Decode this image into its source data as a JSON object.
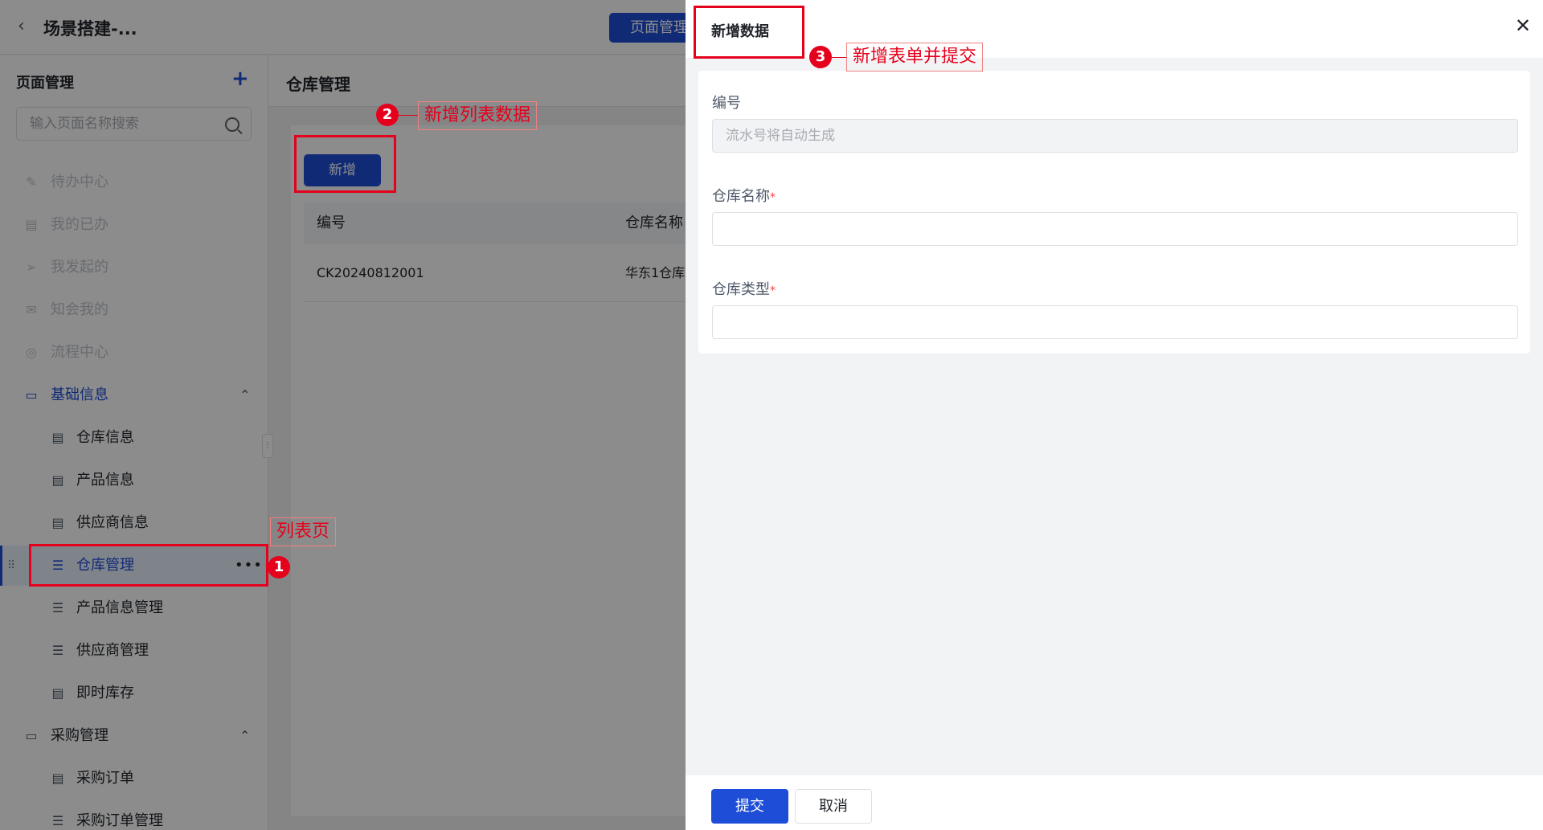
{
  "app": {
    "title": "场景搭建-...",
    "top_button": "页面管理"
  },
  "sidebar": {
    "heading": "页面管理",
    "add_glyph": "+",
    "search_placeholder": "输入页面名称搜索",
    "items": [
      {
        "label": "待办中心",
        "icon": "edit-icon",
        "glyph": "✎"
      },
      {
        "label": "我的已办",
        "icon": "doc-icon",
        "glyph": "▤"
      },
      {
        "label": "我发起的",
        "icon": "send-icon",
        "glyph": "➢"
      },
      {
        "label": "知会我的",
        "icon": "mail-icon",
        "glyph": "✉"
      },
      {
        "label": "流程中心",
        "icon": "flow-icon",
        "glyph": "◎"
      },
      {
        "label": "基础信息",
        "icon": "folder-icon",
        "glyph": "▭"
      },
      {
        "label": "仓库信息",
        "icon": "form-icon",
        "glyph": "▤"
      },
      {
        "label": "产品信息",
        "icon": "form-icon",
        "glyph": "▤"
      },
      {
        "label": "供应商信息",
        "icon": "form-icon",
        "glyph": "▤"
      },
      {
        "label": "仓库管理",
        "icon": "list-icon",
        "glyph": "☰"
      },
      {
        "label": "产品信息管理",
        "icon": "list-icon",
        "glyph": "☰"
      },
      {
        "label": "供应商管理",
        "icon": "list-icon",
        "glyph": "☰"
      },
      {
        "label": "即时库存",
        "icon": "form-icon",
        "glyph": "▤"
      },
      {
        "label": "采购管理",
        "icon": "folder-icon",
        "glyph": "▭"
      },
      {
        "label": "采购订单",
        "icon": "form-icon",
        "glyph": "▤"
      },
      {
        "label": "采购订单管理",
        "icon": "list-icon",
        "glyph": "☰"
      }
    ]
  },
  "main": {
    "title": "仓库管理",
    "add_button": "新增",
    "table": {
      "columns": [
        "编号",
        "仓库名称"
      ],
      "rows": [
        [
          "CK20240812001",
          "华东1仓库"
        ]
      ]
    }
  },
  "drawer": {
    "title": "新增数据",
    "fields": [
      {
        "label": "编号",
        "required": false,
        "placeholder": "流水号将自动生成",
        "disabled": true
      },
      {
        "label": "仓库名称",
        "required": true,
        "placeholder": "",
        "disabled": false
      },
      {
        "label": "仓库类型",
        "required": true,
        "placeholder": "",
        "disabled": false
      }
    ],
    "required_mark": "*",
    "submit_label": "提交",
    "cancel_label": "取消"
  },
  "annotations": {
    "list_page_label": "列表页",
    "step1": {
      "num": "1"
    },
    "step2": {
      "num": "2",
      "text": "新增列表数据"
    },
    "step3": {
      "num": "3",
      "text": "新增表单并提交"
    }
  },
  "colors": {
    "primary": "#1e4ed8",
    "annotation_red": "#e5001c"
  }
}
